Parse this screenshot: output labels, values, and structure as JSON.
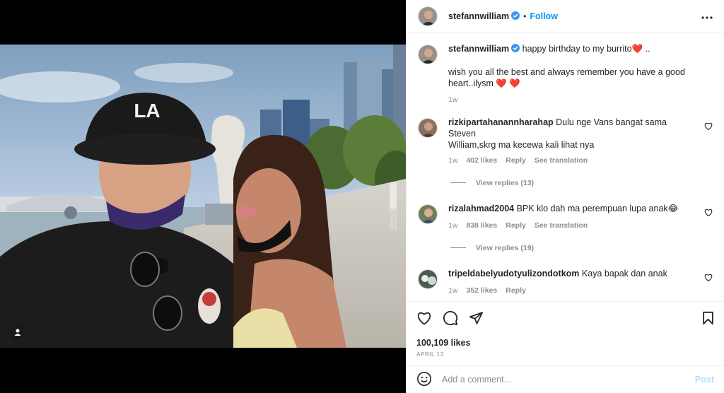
{
  "post": {
    "username": "stefannwilliam",
    "dot": "•",
    "follow_label": "Follow",
    "caption_line1": "happy birthday to my burrito❤️ ..",
    "caption_line2": "wish you all the best and always remember you have a good",
    "caption_line3": "heart..ilysm ❤️ ❤️",
    "caption_time": "1w"
  },
  "comments": [
    {
      "username": "rizkipartahanannharahap",
      "text_line1": "Dulu nge Vans bangat sama Steven",
      "text_line2": "William,skrg ma kecewa kali lihat nya",
      "time": "1w",
      "likes": "402 likes",
      "reply": "Reply",
      "translate": "See translation",
      "view_replies": "View replies (13)",
      "avatar_color": "#8a6f63"
    },
    {
      "username": "rizalahmad2004",
      "text_line1": "BPK klo dah ma perempuan lupa anak😂",
      "time": "1w",
      "likes": "838 likes",
      "reply": "Reply",
      "translate": "See translation",
      "view_replies": "View replies (19)",
      "avatar_color": "#6c7f5a"
    },
    {
      "username": "tripeldabelyudotyulizondotkom",
      "text_line1": "Kaya bapak dan anak",
      "time": "1w",
      "likes": "352 likes",
      "reply": "Reply",
      "avatar_color": "#4d5b4f"
    }
  ],
  "footer": {
    "likes": "100,109 likes",
    "date": "APRIL 13",
    "comment_placeholder": "Add a comment...",
    "post_label": "Post"
  },
  "icons": {
    "verified": "verified-badge-icon",
    "more": "more-options-icon",
    "like": "heart-icon",
    "comment": "comment-icon",
    "share": "share-icon",
    "save": "bookmark-icon",
    "emoji": "emoji-icon",
    "tag": "user-tag-icon"
  },
  "colors": {
    "accent": "#0095f6",
    "verified": "#3897f0",
    "secondary_text": "#8e8e8e",
    "post_disabled": "#b2dffc"
  }
}
